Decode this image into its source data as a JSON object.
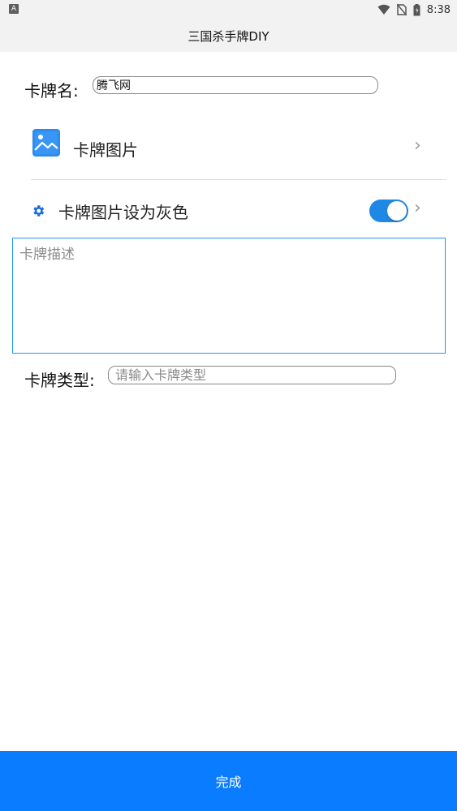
{
  "status_bar": {
    "left_icon": "A",
    "time": "8:38",
    "icons": [
      "wifi-icon",
      "no-sim-icon",
      "battery-icon"
    ]
  },
  "app_bar": {
    "title": "三国杀手牌DIY"
  },
  "form": {
    "name_label": "卡牌名:",
    "name_value": "腾飞网",
    "image_row": {
      "label": "卡牌图片",
      "icon": "image-icon"
    },
    "gray_row": {
      "label": "卡牌图片设为灰色",
      "icon": "gear-icon",
      "toggle_on": true
    },
    "description": {
      "placeholder": "卡牌描述",
      "value": ""
    },
    "type_label": "卡牌类型:",
    "type_placeholder": "请输入卡牌类型",
    "type_value": ""
  },
  "footer": {
    "done_label": "完成"
  },
  "colors": {
    "accent": "#0a7cff",
    "toggle": "#1e88e5",
    "focus_border": "#2196f3"
  }
}
